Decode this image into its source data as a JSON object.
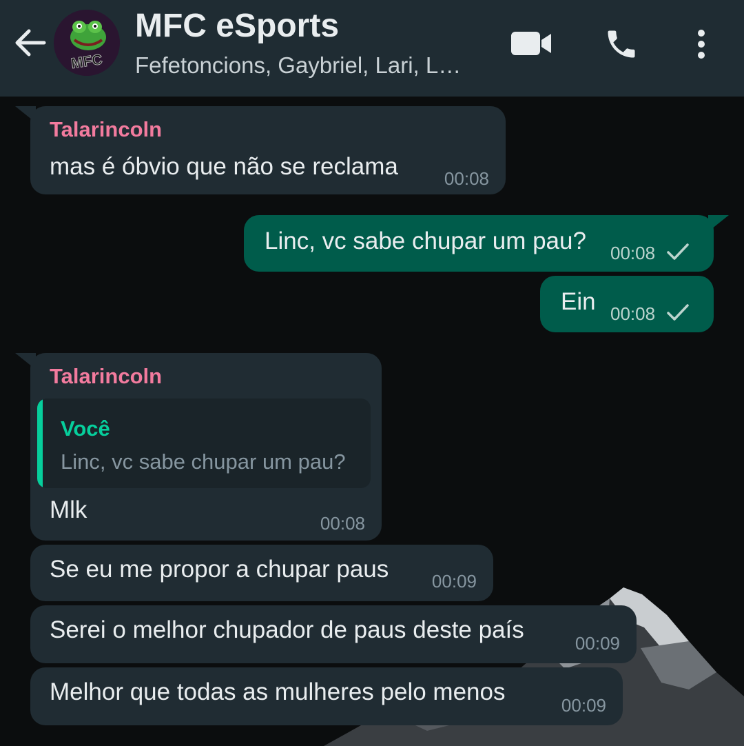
{
  "header": {
    "title": "MFC eSports",
    "subtitle": "Fefetoncions, Gaybriel, Lari, L…",
    "avatar_text": "MFC",
    "icons": [
      "back-arrow-icon",
      "video-call-icon",
      "voice-call-icon",
      "more-options-icon"
    ]
  },
  "colors": {
    "header_bg": "#1f2c33",
    "incoming_bubble": "#202c33",
    "outgoing_bubble": "#005c4b",
    "sender_name": "#f27b9e",
    "quote_accent": "#06cf9c",
    "background": "#0b0d0e"
  },
  "messages": [
    {
      "direction": "in",
      "sender": "Talarincoln",
      "text": "mas é óbvio que não se reclama",
      "time": "00:08"
    },
    {
      "direction": "out",
      "text": "Linc, vc sabe chupar um pau?",
      "time": "00:08",
      "status": "sent"
    },
    {
      "direction": "out",
      "text": "Ein",
      "time": "00:08",
      "status": "sent"
    },
    {
      "direction": "in",
      "sender": "Talarincoln",
      "quote": {
        "author": "Você",
        "text": "Linc, vc sabe chupar um pau?"
      },
      "text": "Mlk",
      "time": "00:08"
    },
    {
      "direction": "in",
      "text": "Se eu me propor a chupar paus",
      "time": "00:09"
    },
    {
      "direction": "in",
      "text": "Serei o melhor chupador de paus deste país",
      "time": "00:09"
    },
    {
      "direction": "in",
      "text": "Melhor que todas as mulheres pelo menos",
      "time": "00:09"
    }
  ]
}
